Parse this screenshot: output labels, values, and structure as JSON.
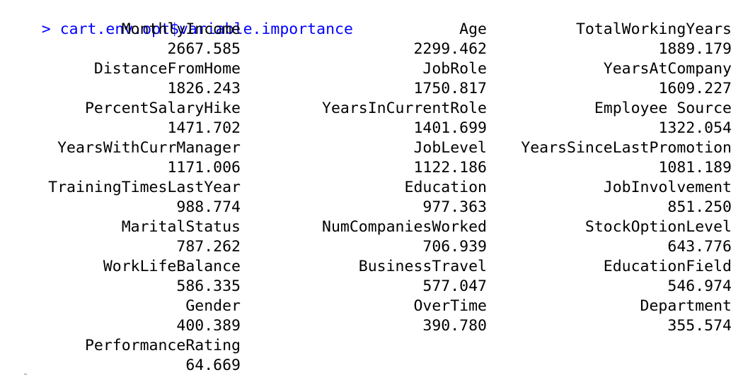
{
  "console": {
    "prompt_symbol": ">",
    "command": "cart.env.opt$variable.importance",
    "colors": {
      "command": "#0000ff",
      "output": "#000000",
      "background": "#ffffff"
    }
  },
  "output": {
    "rows": [
      [
        {
          "name": "MonthlyIncome",
          "value": "2667.585"
        },
        {
          "name": "Age",
          "value": "2299.462"
        },
        {
          "name": "TotalWorkingYears",
          "value": "1889.179"
        }
      ],
      [
        {
          "name": "DistanceFromHome",
          "value": "1826.243"
        },
        {
          "name": "JobRole",
          "value": "1750.817"
        },
        {
          "name": "YearsAtCompany",
          "value": "1609.227"
        }
      ],
      [
        {
          "name": "PercentSalaryHike",
          "value": "1471.702"
        },
        {
          "name": "YearsInCurrentRole",
          "value": "1401.699"
        },
        {
          "name": "Employee Source",
          "value": "1322.054"
        }
      ],
      [
        {
          "name": "YearsWithCurrManager",
          "value": "1171.006"
        },
        {
          "name": "JobLevel",
          "value": "1122.186"
        },
        {
          "name": "YearsSinceLastPromotion",
          "value": "1081.189"
        }
      ],
      [
        {
          "name": "TrainingTimesLastYear",
          "value": "988.774"
        },
        {
          "name": "Education",
          "value": "977.363"
        },
        {
          "name": "JobInvolvement",
          "value": "851.250"
        }
      ],
      [
        {
          "name": "MaritalStatus",
          "value": "787.262"
        },
        {
          "name": "NumCompaniesWorked",
          "value": "706.939"
        },
        {
          "name": "StockOptionLevel",
          "value": "643.776"
        }
      ],
      [
        {
          "name": "WorkLifeBalance",
          "value": "586.335"
        },
        {
          "name": "BusinessTravel",
          "value": "577.047"
        },
        {
          "name": "EducationField",
          "value": "546.974"
        }
      ],
      [
        {
          "name": "Gender",
          "value": "400.389"
        },
        {
          "name": "OverTime",
          "value": "390.780"
        },
        {
          "name": "Department",
          "value": "355.574"
        }
      ],
      [
        {
          "name": "PerformanceRating",
          "value": "64.669"
        }
      ]
    ]
  }
}
